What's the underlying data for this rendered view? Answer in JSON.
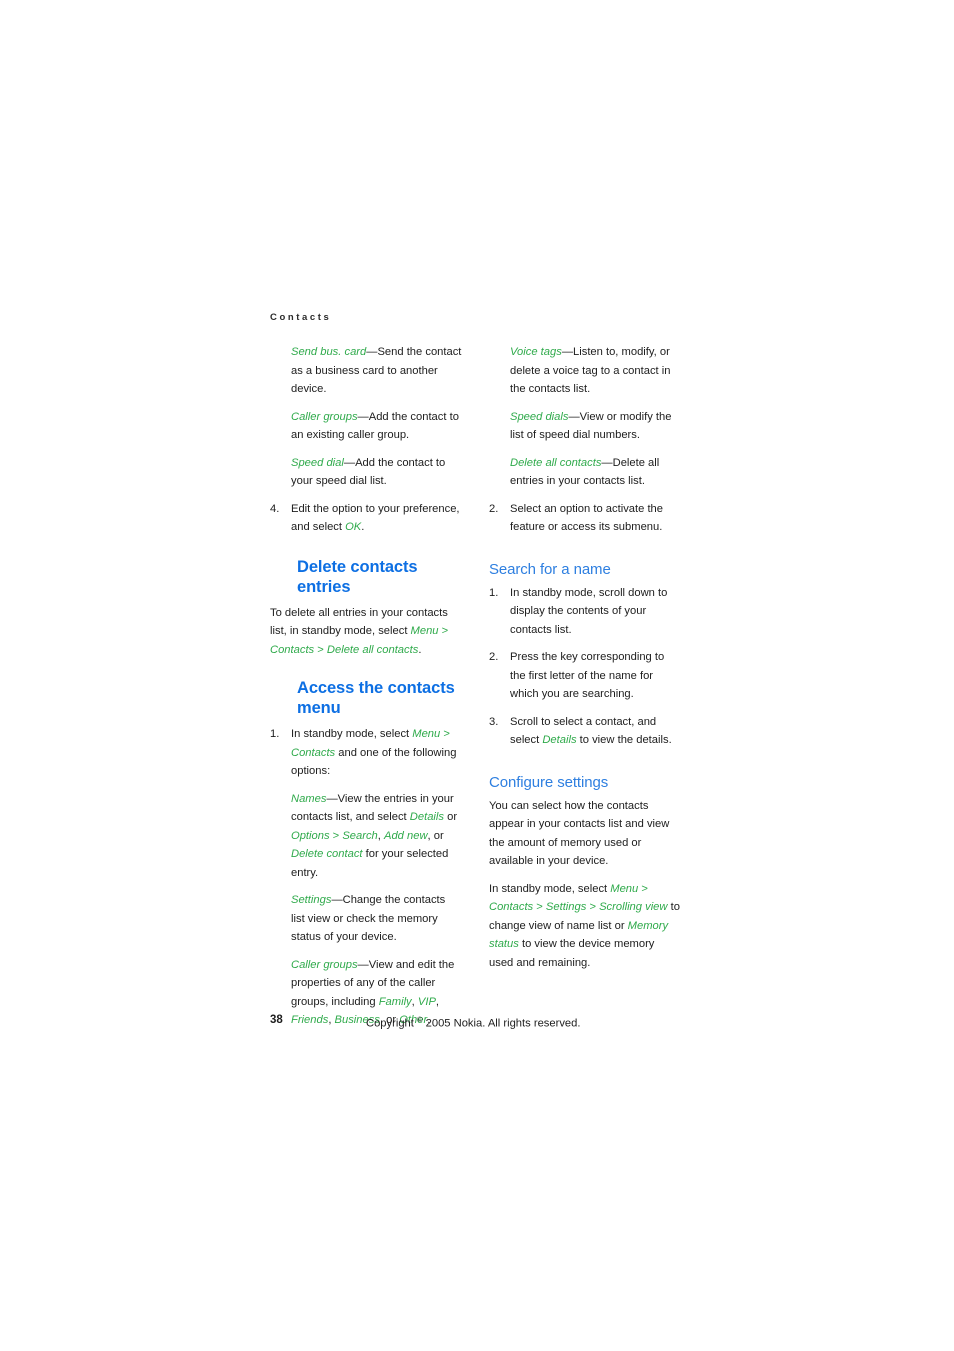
{
  "document": {
    "running_header": "Contacts",
    "page_number": "38",
    "copyright_prefix": "Copyright ",
    "copyright_symbol": "©",
    "copyright_suffix": " 2005 Nokia. All rights reserved.",
    "colors": {
      "heading_blue_bold": "#0d6fe3",
      "heading_blue_light": "#2e7fe0",
      "ui_term_green": "#2faa4b",
      "body_text": "#1d1d1d",
      "page_background": "#ffffff"
    }
  },
  "left_column": {
    "options_continued": [
      {
        "term": "Send bus. card",
        "dash": "—",
        "text": "Send the contact as a business card to another device."
      },
      {
        "term": "Caller groups",
        "dash": "—",
        "text": "Add the contact to an existing caller group."
      },
      {
        "term": "Speed dial",
        "dash": "—",
        "text": "Add the contact to your speed dial list."
      }
    ],
    "step_4": {
      "number": "4.",
      "text_before": "Edit the option to your preference, and select ",
      "term": "OK",
      "text_after": "."
    },
    "section_delete": {
      "heading_line1": "Delete contacts",
      "heading_line2": "entries",
      "body_part1": "To delete all entries in your contacts list, in standby mode, select ",
      "body_term1": "Menu",
      "body_sep1": " > ",
      "body_term2": "Contacts",
      "body_sep2": " > ",
      "body_term3": "Delete all contacts",
      "body_end": "."
    },
    "section_access": {
      "heading_line1": "Access the contacts",
      "heading_line2": "menu",
      "step_1": {
        "number": "1.",
        "part1": "In standby mode, select ",
        "term1": "Menu",
        "sep1": " > ",
        "term2": "Contacts",
        "part2": " and one of the following options:"
      },
      "options": [
        {
          "term": "Names",
          "dash": "—",
          "part1": "View the entries in your contacts list, and select ",
          "term2": "Details",
          "part2": " or ",
          "term3": "Options",
          "sep1": " > ",
          "term4": "Search",
          "sep2": ", ",
          "term5": "Add new",
          "part3": ", or ",
          "term6": "Delete contact",
          "part4": " for your selected entry."
        },
        {
          "term": "Settings",
          "dash": "—",
          "part1": "Change the contacts list view or check the memory status of your device."
        },
        {
          "term": "Caller groups",
          "dash": "—",
          "part1": "View and edit the properties of any of the caller groups, including ",
          "term2": "Family",
          "sep1": ", ",
          "term3": "VIP",
          "sep2": ", ",
          "term4": "Friends",
          "sep3": ", ",
          "term5": "Business",
          "part2": ", or ",
          "term6": "Other",
          "part3": "."
        }
      ]
    }
  },
  "right_column": {
    "options_continued": [
      {
        "term": "Voice tags",
        "dash": "—",
        "text": "Listen to, modify, or delete a voice tag to a contact in the contacts list."
      },
      {
        "term": "Speed dials",
        "dash": "—",
        "text": "View or modify the list of speed dial numbers."
      },
      {
        "term": "Delete all contacts",
        "dash": "—",
        "text": "Delete all entries in your contacts list."
      }
    ],
    "step_2": {
      "number": "2.",
      "text": "Select an option to activate the feature or access its submenu."
    },
    "section_search": {
      "heading": "Search for a name",
      "steps": [
        {
          "number": "1.",
          "text": "In standby mode, scroll down to display the contents of your contacts list."
        },
        {
          "number": "2.",
          "text": "Press the key corresponding to the first letter of the name for which you are searching."
        },
        {
          "number": "3.",
          "part1": "Scroll to select a contact, and select ",
          "term": "Details",
          "part2": " to view the details."
        }
      ]
    },
    "section_configure": {
      "heading": "Configure settings",
      "body1": "You can select how the contacts appear in your contacts list and view the amount of memory used or available in your device.",
      "body2": {
        "part1": "In standby mode, select ",
        "term1": "Menu",
        "sep1": " > ",
        "term2": "Contacts",
        "sep2": " > ",
        "term3": "Settings",
        "sep3": " > ",
        "term4": "Scrolling view",
        "part2": " to change view of name list or ",
        "term5": "Memory status",
        "part3": " to view the device memory used and remaining."
      }
    }
  }
}
